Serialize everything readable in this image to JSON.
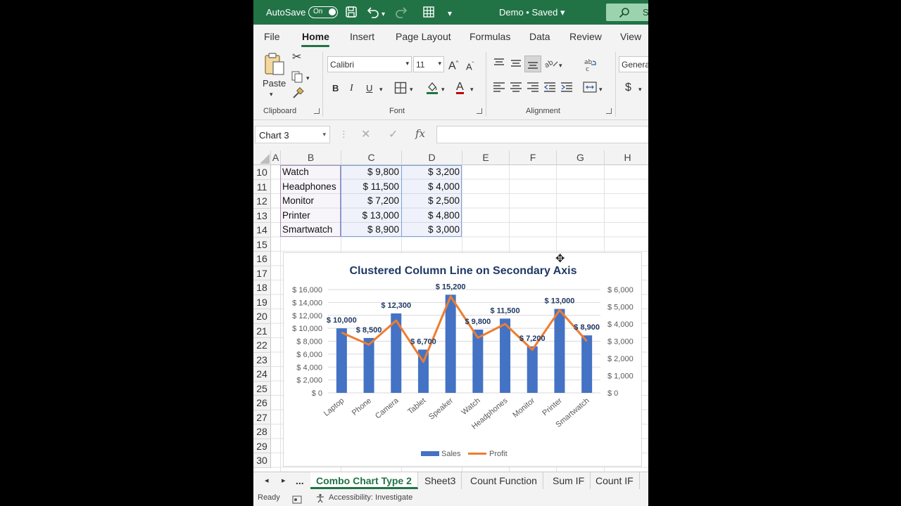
{
  "titlebar": {
    "autosave_label": "AutoSave",
    "toggle_state": "On",
    "doc_name": "Demo • Saved",
    "search_fragment": "S",
    "accent_color": "#217346"
  },
  "ribbon_tabs": [
    "File",
    "Home",
    "Insert",
    "Page Layout",
    "Formulas",
    "Data",
    "Review",
    "View"
  ],
  "ribbon": {
    "paste_label": "Paste",
    "clipboard_label": "Clipboard",
    "font_name": "Calibri",
    "font_size": "11",
    "font_label": "Font",
    "bold": "B",
    "italic": "I",
    "underline": "U",
    "font_color_glyph": "A",
    "grow_font": "A",
    "shrink_font": "A",
    "alignment_label": "Alignment",
    "number_format": "Genera",
    "currency": "$"
  },
  "formula_bar": {
    "name_box": "Chart 3",
    "cancel": "✕",
    "enter": "✓",
    "fx": "fx",
    "value": ""
  },
  "columns": [
    "A",
    "B",
    "C",
    "D",
    "E",
    "F",
    "G",
    "H"
  ],
  "rows": [
    "10",
    "11",
    "12",
    "13",
    "14",
    "15",
    "16",
    "17",
    "18",
    "19",
    "20",
    "21",
    "22",
    "23",
    "24",
    "25",
    "26",
    "27",
    "28",
    "29",
    "30"
  ],
  "table_rows": [
    {
      "product": "Watch",
      "sales": "$ 9,800",
      "profit": "$ 3,200"
    },
    {
      "product": "Headphones",
      "sales": "$ 11,500",
      "profit": "$ 4,000"
    },
    {
      "product": "Monitor",
      "sales": "$ 7,200",
      "profit": "$ 2,500"
    },
    {
      "product": "Printer",
      "sales": "$ 13,000",
      "profit": "$ 4,800"
    },
    {
      "product": "Smartwatch",
      "sales": "$ 8,900",
      "profit": "$ 3,000"
    }
  ],
  "chart_data": {
    "type": "bar",
    "title": "Clustered Column Line on Secondary Axis",
    "categories": [
      "Laptop",
      "Phone",
      "Camera",
      "Tablet",
      "Speaker",
      "Watch",
      "Headphones",
      "Monitor",
      "Printer",
      "Smartwatch"
    ],
    "series": [
      {
        "name": "Sales",
        "type": "bar",
        "axis": "primary",
        "color": "#4472c4",
        "values": [
          10000,
          8500,
          12300,
          6700,
          15200,
          9800,
          11500,
          7200,
          13000,
          8900
        ]
      },
      {
        "name": "Profit",
        "type": "line",
        "axis": "secondary",
        "color": "#ed7d31",
        "values": [
          3500,
          2800,
          4200,
          1800,
          5600,
          3200,
          4000,
          2500,
          4800,
          3000
        ]
      }
    ],
    "data_labels": [
      "$ 10,000",
      "$ 8,500",
      "$ 12,300",
      "$ 6,700",
      "$ 15,200",
      "$ 9,800",
      "$ 11,500",
      "$ 7,200",
      "$ 13,000",
      "$ 8,900"
    ],
    "ylim": [
      0,
      16000
    ],
    "y_ticks": [
      "$ 0",
      "$ 2,000",
      "$ 4,000",
      "$ 6,000",
      "$ 8,000",
      "$ 10,000",
      "$ 12,000",
      "$ 14,000",
      "$ 16,000"
    ],
    "y2lim": [
      0,
      6000
    ],
    "y2_ticks": [
      "$ 0",
      "$ 1,000",
      "$ 2,000",
      "$ 3,000",
      "$ 4,000",
      "$ 5,000",
      "$ 6,000"
    ],
    "legend_position": "bottom",
    "grid": true
  },
  "sheet_tabs": [
    "...",
    "Combo Chart Type 2",
    "Sheet3",
    "Count Function",
    "Sum IF",
    "Count IF"
  ],
  "active_sheet": "Combo Chart Type 2",
  "status": {
    "ready": "Ready",
    "accessibility": "Accessibility: Investigate"
  }
}
